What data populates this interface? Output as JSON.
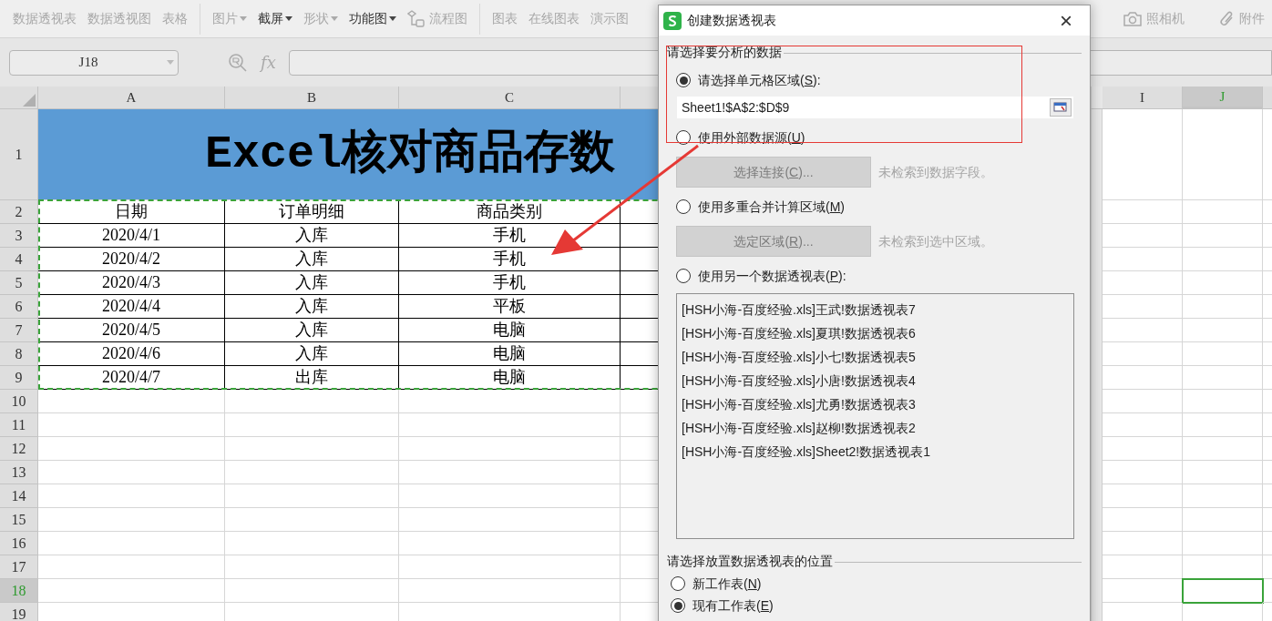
{
  "toolbar": {
    "groups": [
      [
        {
          "label": "数据透视表",
          "disabled": true,
          "dropdown": false,
          "kind": "text"
        },
        {
          "label": "数据透视图",
          "disabled": true,
          "dropdown": false,
          "kind": "text"
        },
        {
          "label": "表格",
          "disabled": true,
          "dropdown": false,
          "kind": "text"
        }
      ],
      [
        {
          "label": "图片",
          "disabled": true,
          "dropdown": true,
          "kind": "text"
        },
        {
          "label": "截屏",
          "disabled": false,
          "dropdown": true,
          "kind": "text"
        },
        {
          "label": "形状",
          "disabled": true,
          "dropdown": true,
          "kind": "text"
        },
        {
          "label": "功能图",
          "disabled": false,
          "dropdown": true,
          "kind": "text"
        },
        {
          "label": "流程图",
          "disabled": true,
          "dropdown": false,
          "kind": "flowchart"
        }
      ],
      [
        {
          "label": "图表",
          "disabled": true,
          "dropdown": false,
          "kind": "text"
        },
        {
          "label": "在线图表",
          "disabled": true,
          "dropdown": false,
          "kind": "text"
        },
        {
          "label": "演示图",
          "disabled": true,
          "dropdown": false,
          "kind": "text"
        }
      ]
    ],
    "right": [
      {
        "label": "照相机",
        "disabled": true,
        "dropdown": false,
        "kind": "camera"
      },
      {
        "label": "附件",
        "disabled": true,
        "dropdown": false,
        "kind": "attachment"
      }
    ]
  },
  "name_box": "J18",
  "formula_bar": {
    "fx": "fx"
  },
  "columns": [
    {
      "letter": "A",
      "selected": false
    },
    {
      "letter": "B",
      "selected": false
    },
    {
      "letter": "C",
      "selected": false
    },
    {
      "letter": "I",
      "selected": false
    },
    {
      "letter": "J",
      "selected": true
    }
  ],
  "rows": [
    {
      "number": "1",
      "selected": false
    },
    {
      "number": "2",
      "selected": false
    },
    {
      "number": "3",
      "selected": false
    },
    {
      "number": "4",
      "selected": false
    },
    {
      "number": "5",
      "selected": false
    },
    {
      "number": "6",
      "selected": false
    },
    {
      "number": "7",
      "selected": false
    },
    {
      "number": "8",
      "selected": false
    },
    {
      "number": "9",
      "selected": false
    },
    {
      "number": "10",
      "selected": false
    },
    {
      "number": "11",
      "selected": false
    },
    {
      "number": "12",
      "selected": false
    },
    {
      "number": "13",
      "selected": false
    },
    {
      "number": "14",
      "selected": false
    },
    {
      "number": "15",
      "selected": false
    },
    {
      "number": "16",
      "selected": false
    },
    {
      "number": "17",
      "selected": false
    },
    {
      "number": "18",
      "selected": true
    },
    {
      "number": "19",
      "selected": false
    }
  ],
  "sheet": {
    "title": "Excel核对商品存数",
    "header": [
      "日期",
      "订单明细",
      "商品类别"
    ],
    "records": [
      [
        "2020/4/1",
        "入库",
        "手机"
      ],
      [
        "2020/4/2",
        "入库",
        "手机"
      ],
      [
        "2020/4/3",
        "入库",
        "手机"
      ],
      [
        "2020/4/4",
        "入库",
        "平板"
      ],
      [
        "2020/4/5",
        "入库",
        "电脑"
      ],
      [
        "2020/4/6",
        "入库",
        "电脑"
      ],
      [
        "2020/4/7",
        "出库",
        "电脑"
      ]
    ]
  },
  "dialog": {
    "title": "创建数据透视表",
    "close": "×",
    "source_section": "请选择要分析的数据",
    "options": [
      {
        "kind": "range",
        "label": "请选择单元格区域(",
        "key": "S",
        "label_end": "):",
        "selected": true,
        "value": "Sheet1!$A$2:$D$9"
      },
      {
        "kind": "action",
        "label": "使用外部数据源(",
        "key": "U",
        "label_end": ")",
        "selected": false,
        "button": {
          "label": "选择连接(",
          "key": "C",
          "label_end": ")...",
          "disabled": true
        },
        "hint": "未检索到数据字段。"
      },
      {
        "kind": "action",
        "label": "使用多重合并计算区域(",
        "key": "M",
        "label_end": ")",
        "selected": false,
        "button": {
          "label": "选定区域(",
          "key": "R",
          "label_end": ")...",
          "disabled": true
        },
        "hint": "未检索到选中区域。"
      },
      {
        "kind": "list",
        "label": "使用另一个数据透视表(",
        "key": "P",
        "label_end": "):",
        "selected": false,
        "items": [
          "[HSH小海-百度经验.xls]王武!数据透视表7",
          "[HSH小海-百度经验.xls]夏琪!数据透视表6",
          "[HSH小海-百度经验.xls]小七!数据透视表5",
          "[HSH小海-百度经验.xls]小唐!数据透视表4",
          "[HSH小海-百度经验.xls]尤勇!数据透视表3",
          "[HSH小海-百度经验.xls]赵柳!数据透视表2",
          "[HSH小海-百度经验.xls]Sheet2!数据透视表1"
        ]
      }
    ],
    "target_section": "请选择放置数据透视表的位置",
    "targets": [
      {
        "label": "新工作表(",
        "key": "N",
        "label_end": ")",
        "selected": false
      },
      {
        "label": "现有工作表(",
        "key": "E",
        "label_end": ")",
        "selected": true
      }
    ]
  }
}
